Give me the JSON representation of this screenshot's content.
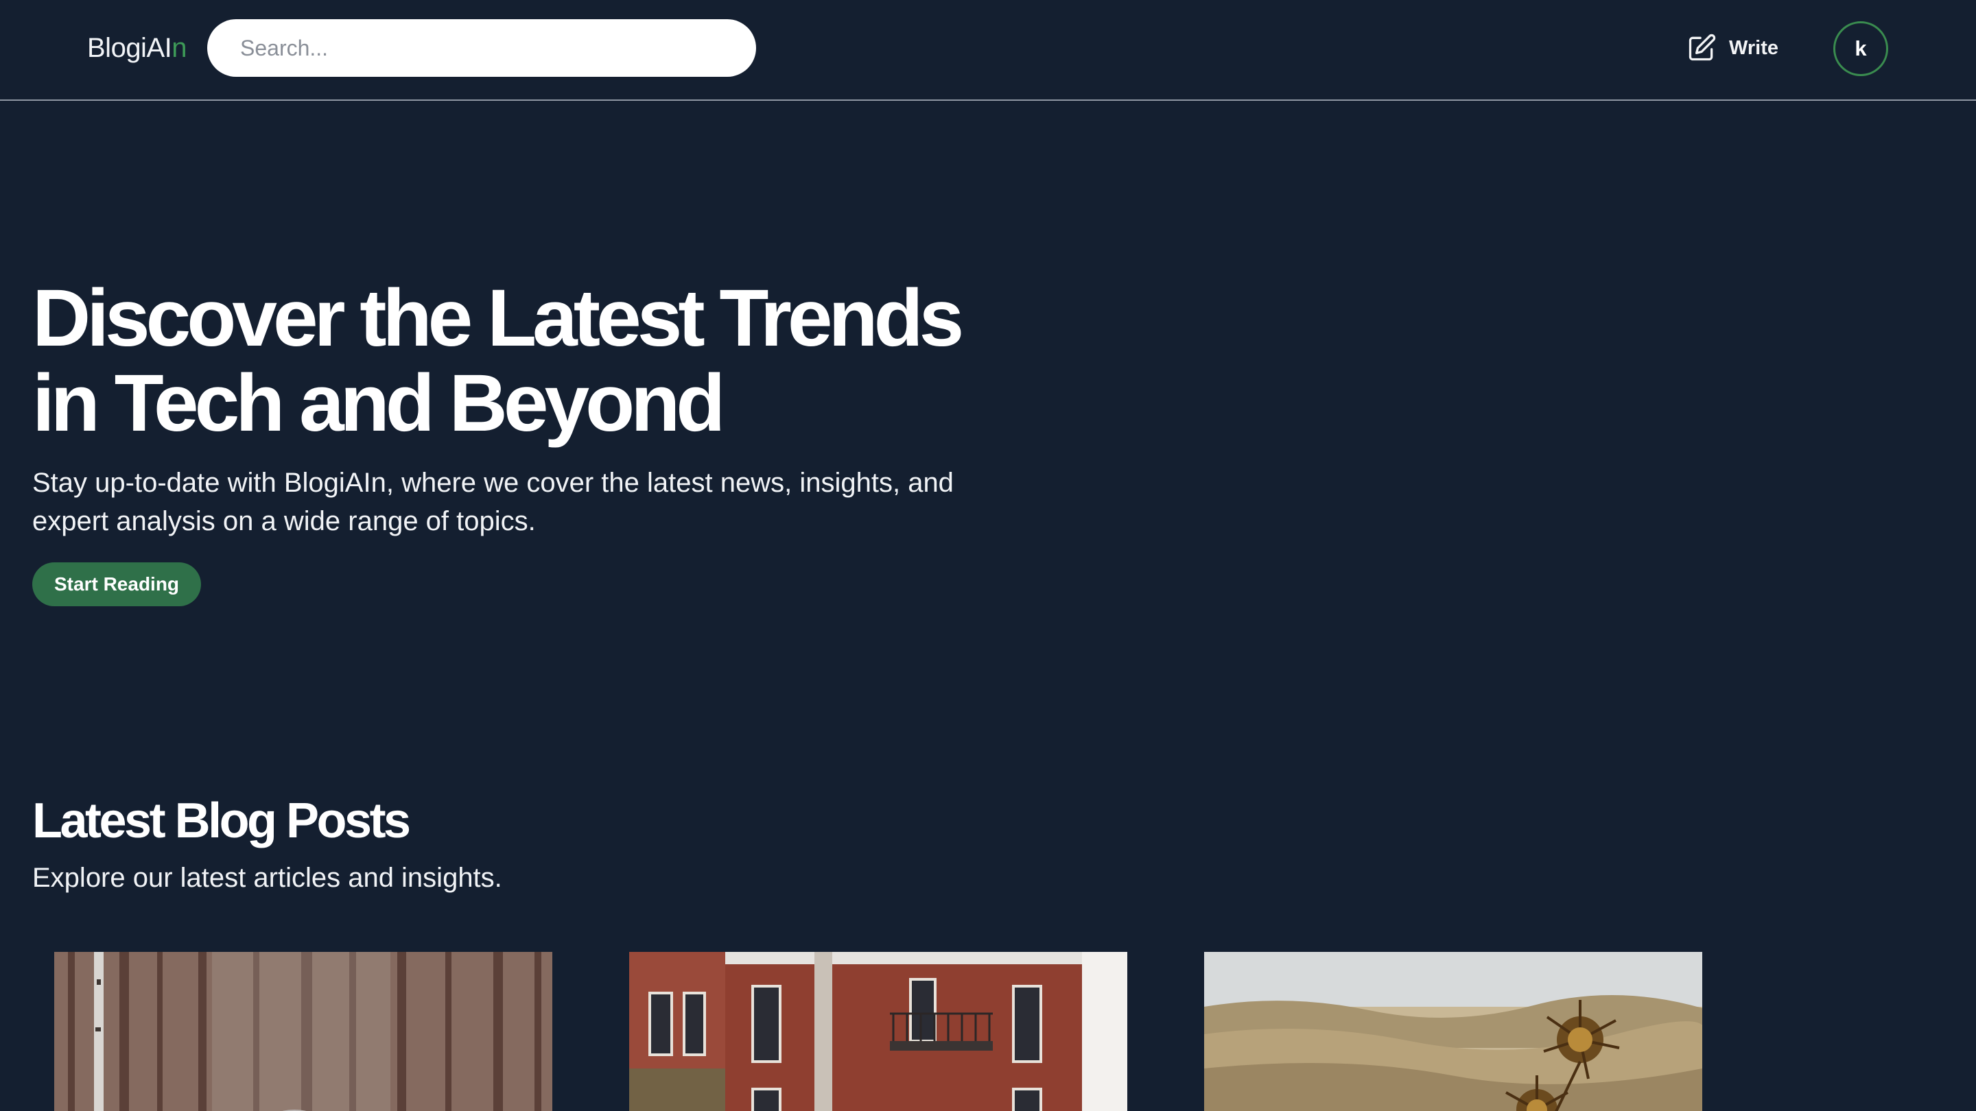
{
  "header": {
    "logo_main": "BlogiAI",
    "logo_accent": "n",
    "search_placeholder": "Search...",
    "write_label": "Write",
    "avatar_initial": "k"
  },
  "hero": {
    "title": "Discover the Latest Trends in Tech and Beyond",
    "subtitle": "Stay up-to-date with BlogiAIn, where we cover the latest news, insights, and expert analysis on a wide range of topics.",
    "cta_label": "Start Reading"
  },
  "latest": {
    "title": "Latest Blog Posts",
    "subtitle": "Explore our latest articles and insights."
  },
  "colors": {
    "background": "#141f30",
    "accent": "#3d9a57",
    "button": "#2f7049"
  }
}
